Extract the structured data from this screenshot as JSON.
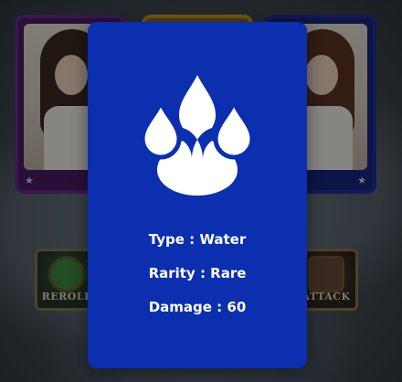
{
  "background": {
    "cards": [
      {
        "frame_color": "#6b2a8f",
        "corner_icon": "star-icon"
      },
      {
        "frame_color": "#c99a2e"
      },
      {
        "frame_color": "#1f2f9a",
        "corner_icon": "water-drops-icon"
      }
    ],
    "buttons": {
      "reroll_label": "REROLL",
      "attack_label": "ATTACK"
    }
  },
  "detail": {
    "card_color": "#0b2fae",
    "icon": "water-drops-icon",
    "type_text": "Type : Water",
    "rarity_text": "Rarity : Rare",
    "damage_text": "Damage : 60"
  }
}
